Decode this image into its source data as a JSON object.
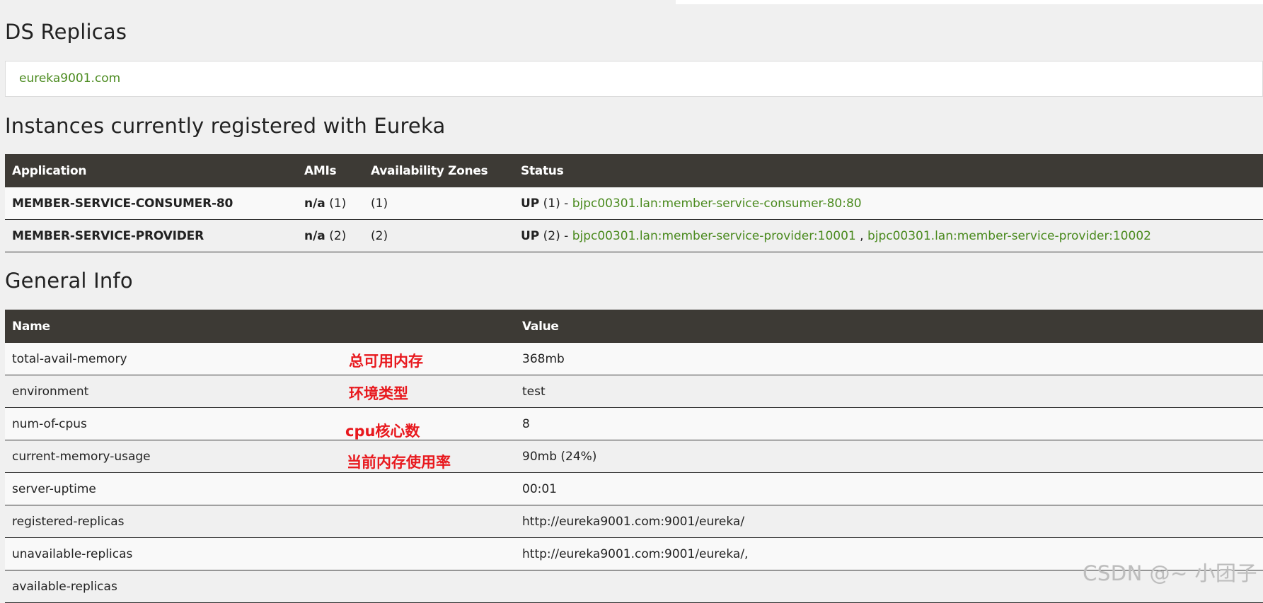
{
  "headings": {
    "ds_replicas": "DS Replicas",
    "instances": "Instances currently registered with Eureka",
    "general_info": "General Info"
  },
  "replicas": {
    "link": "eureka9001.com"
  },
  "instances_table": {
    "headers": [
      "Application",
      "AMIs",
      "Availability Zones",
      "Status"
    ],
    "rows": [
      {
        "application": "MEMBER-SERVICE-CONSUMER-80",
        "amis_label": "n/a",
        "amis_count": " (1)",
        "zones": "(1)",
        "status_label": "UP",
        "status_count": " (1) - ",
        "links": [
          "bjpc00301.lan:member-service-consumer-80:80"
        ]
      },
      {
        "application": "MEMBER-SERVICE-PROVIDER",
        "amis_label": "n/a",
        "amis_count": " (2)",
        "zones": "(2)",
        "status_label": "UP",
        "status_count": " (2) - ",
        "links": [
          "bjpc00301.lan:member-service-provider:10001",
          "bjpc00301.lan:member-service-provider:10002"
        ],
        "link_separator": " , "
      }
    ]
  },
  "general_table": {
    "headers": [
      "Name",
      "Value"
    ],
    "rows": [
      {
        "name": "total-avail-memory",
        "value": "368mb"
      },
      {
        "name": "environment",
        "value": "test"
      },
      {
        "name": "num-of-cpus",
        "value": "8"
      },
      {
        "name": "current-memory-usage",
        "value": "90mb (24%)"
      },
      {
        "name": "server-uptime",
        "value": "00:01"
      },
      {
        "name": "registered-replicas",
        "value": "http://eureka9001.com:9001/eureka/"
      },
      {
        "name": "unavailable-replicas",
        "value": "http://eureka9001.com:9001/eureka/,"
      },
      {
        "name": "available-replicas",
        "value": ""
      }
    ]
  },
  "annotations": [
    "总可用内存",
    "环境类型",
    "cpu核心数",
    "当前内存使用率"
  ],
  "watermark": "CSDN @~ 小团子",
  "colors": {
    "header_bg": "#3d3a35",
    "link_green": "#4a8a1e",
    "annotation_red": "#e8191e",
    "page_bg": "#f0f0f0"
  }
}
